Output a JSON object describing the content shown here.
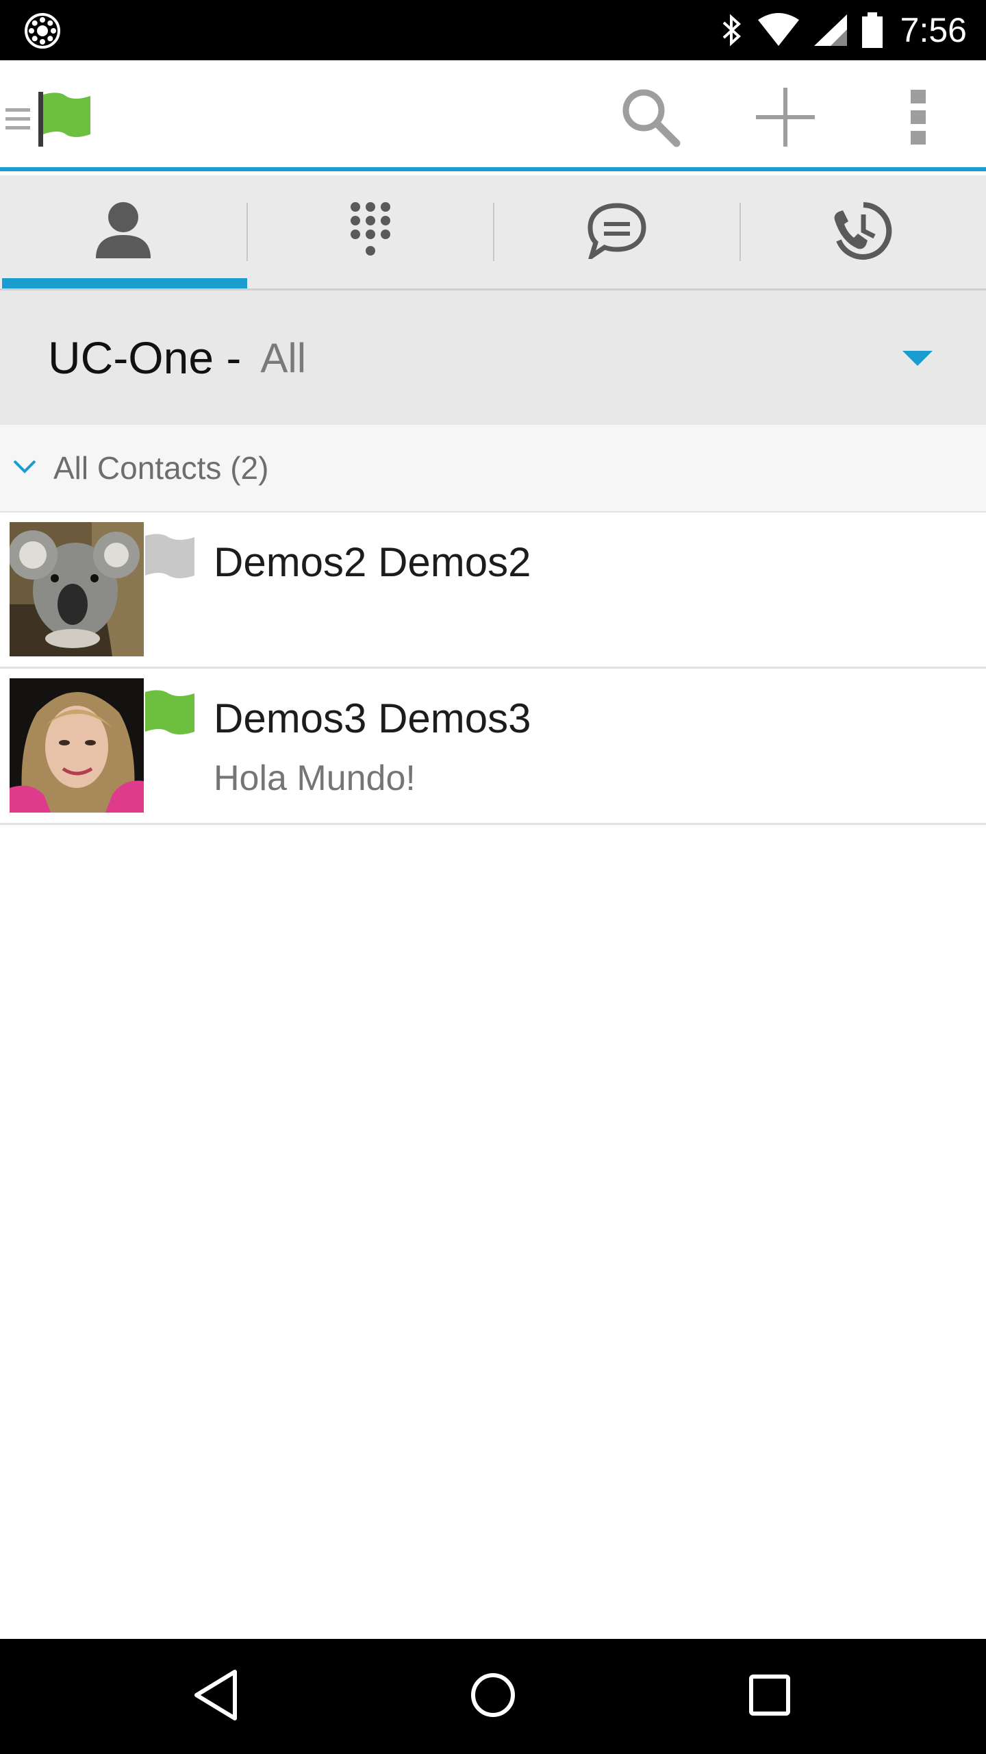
{
  "status_bar": {
    "time": "7:56",
    "left_icon": "settings-wheel-icon",
    "icons": [
      "bluetooth-icon",
      "wifi-icon",
      "cell-signal-icon",
      "battery-icon"
    ]
  },
  "app_bar": {
    "nav_icon": "drawer-menu-icon",
    "presence_icon": "green-flag-icon",
    "actions": [
      "search-icon",
      "add-icon",
      "overflow-menu-icon"
    ]
  },
  "tabs": [
    {
      "icon": "contacts-person-icon",
      "selected": true
    },
    {
      "icon": "dialpad-icon",
      "selected": false
    },
    {
      "icon": "chat-bubble-icon",
      "selected": false
    },
    {
      "icon": "call-history-icon",
      "selected": false
    }
  ],
  "account_selector": {
    "account": "UC-One -",
    "filter": "All"
  },
  "group": {
    "label": "All Contacts (2)"
  },
  "contacts": [
    {
      "name": "Demos2 Demos2",
      "status_message": "",
      "presence": "offline",
      "presence_color": "#c8c8c8",
      "avatar": "koala-photo"
    },
    {
      "name": "Demos3 Demos3",
      "status_message": "Hola Mundo!",
      "presence": "available",
      "presence_color": "#6cbf3f",
      "avatar": "woman-photo"
    }
  ],
  "colors": {
    "accent": "#1a9cd0",
    "available": "#6cbf3f",
    "offline": "#c8c8c8"
  },
  "nav_bar": [
    "back-icon",
    "home-icon",
    "recents-icon"
  ]
}
